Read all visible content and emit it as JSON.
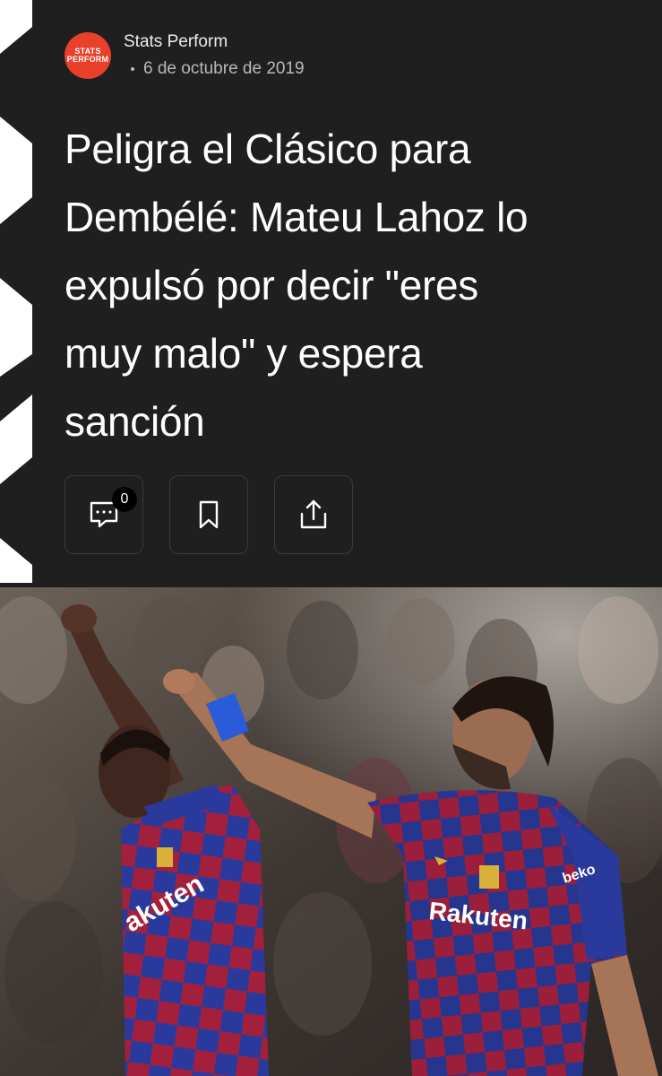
{
  "source": {
    "name": "Stats Perform",
    "logo_line1": "STATS",
    "logo_line2": "PERFORM",
    "date": "6 de octubre de 2019"
  },
  "article": {
    "headline_lines": [
      "Peligra el Clásico para",
      "Dembélé: Mateu Lahoz lo",
      "expulsó por decir \"eres",
      "muy malo\" y espera",
      "sanción"
    ]
  },
  "actions": {
    "comment_count": "0",
    "comment_icon": "comment-icon",
    "bookmark_icon": "bookmark-icon",
    "share_icon": "share-icon"
  },
  "photo": {
    "jersey_text_left": "akuten",
    "jersey_text_right": "Rakuten",
    "sleeve_text": "beko"
  },
  "colors": {
    "background": "#1f1f1f",
    "logo": "#e8402a",
    "text_primary": "#ffffff",
    "text_secondary": "#b9b9b9",
    "jersey_blue": "#2a3a9c",
    "jersey_red": "#a3203c"
  }
}
